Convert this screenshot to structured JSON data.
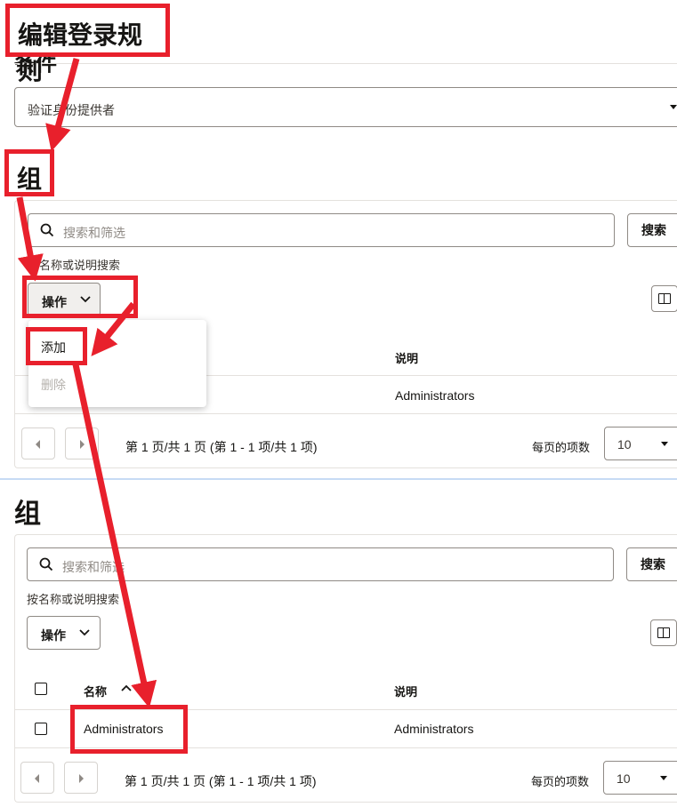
{
  "annotations": {
    "title": "编辑登录规则",
    "group_label": "组"
  },
  "conditions": {
    "heading_partial": "条件",
    "provider_select": "验证身份提供者"
  },
  "groups_top": {
    "search_placeholder": "搜索和筛选",
    "search_button": "搜索",
    "helper": "按名称或说明搜索",
    "actions_button": "操作",
    "menu": {
      "add": "添加",
      "delete": "删除"
    },
    "table": {
      "col_description": "说明",
      "rows": [
        {
          "description": "Administrators"
        }
      ]
    },
    "pagination": {
      "summary": "第 1 页/共 1 页 (第 1 - 1 项/共 1 项)",
      "per_page_label": "每页的项数",
      "per_page_value": "10"
    }
  },
  "groups_bottom": {
    "heading": "组",
    "search_placeholder": "搜索和筛选",
    "search_button": "搜索",
    "helper": "按名称或说明搜索",
    "actions_button": "操作",
    "table": {
      "col_name": "名称",
      "col_description": "说明",
      "rows": [
        {
          "name": "Administrators",
          "description": "Administrators"
        }
      ]
    },
    "pagination": {
      "summary": "第 1 页/共 1 页 (第 1 - 1 项/共 1 项)",
      "per_page_label": "每页的项数",
      "per_page_value": "10"
    }
  },
  "colors": {
    "annotation_red": "#e8202c",
    "divider_blue": "#c7dbf5",
    "text": "#161513"
  }
}
